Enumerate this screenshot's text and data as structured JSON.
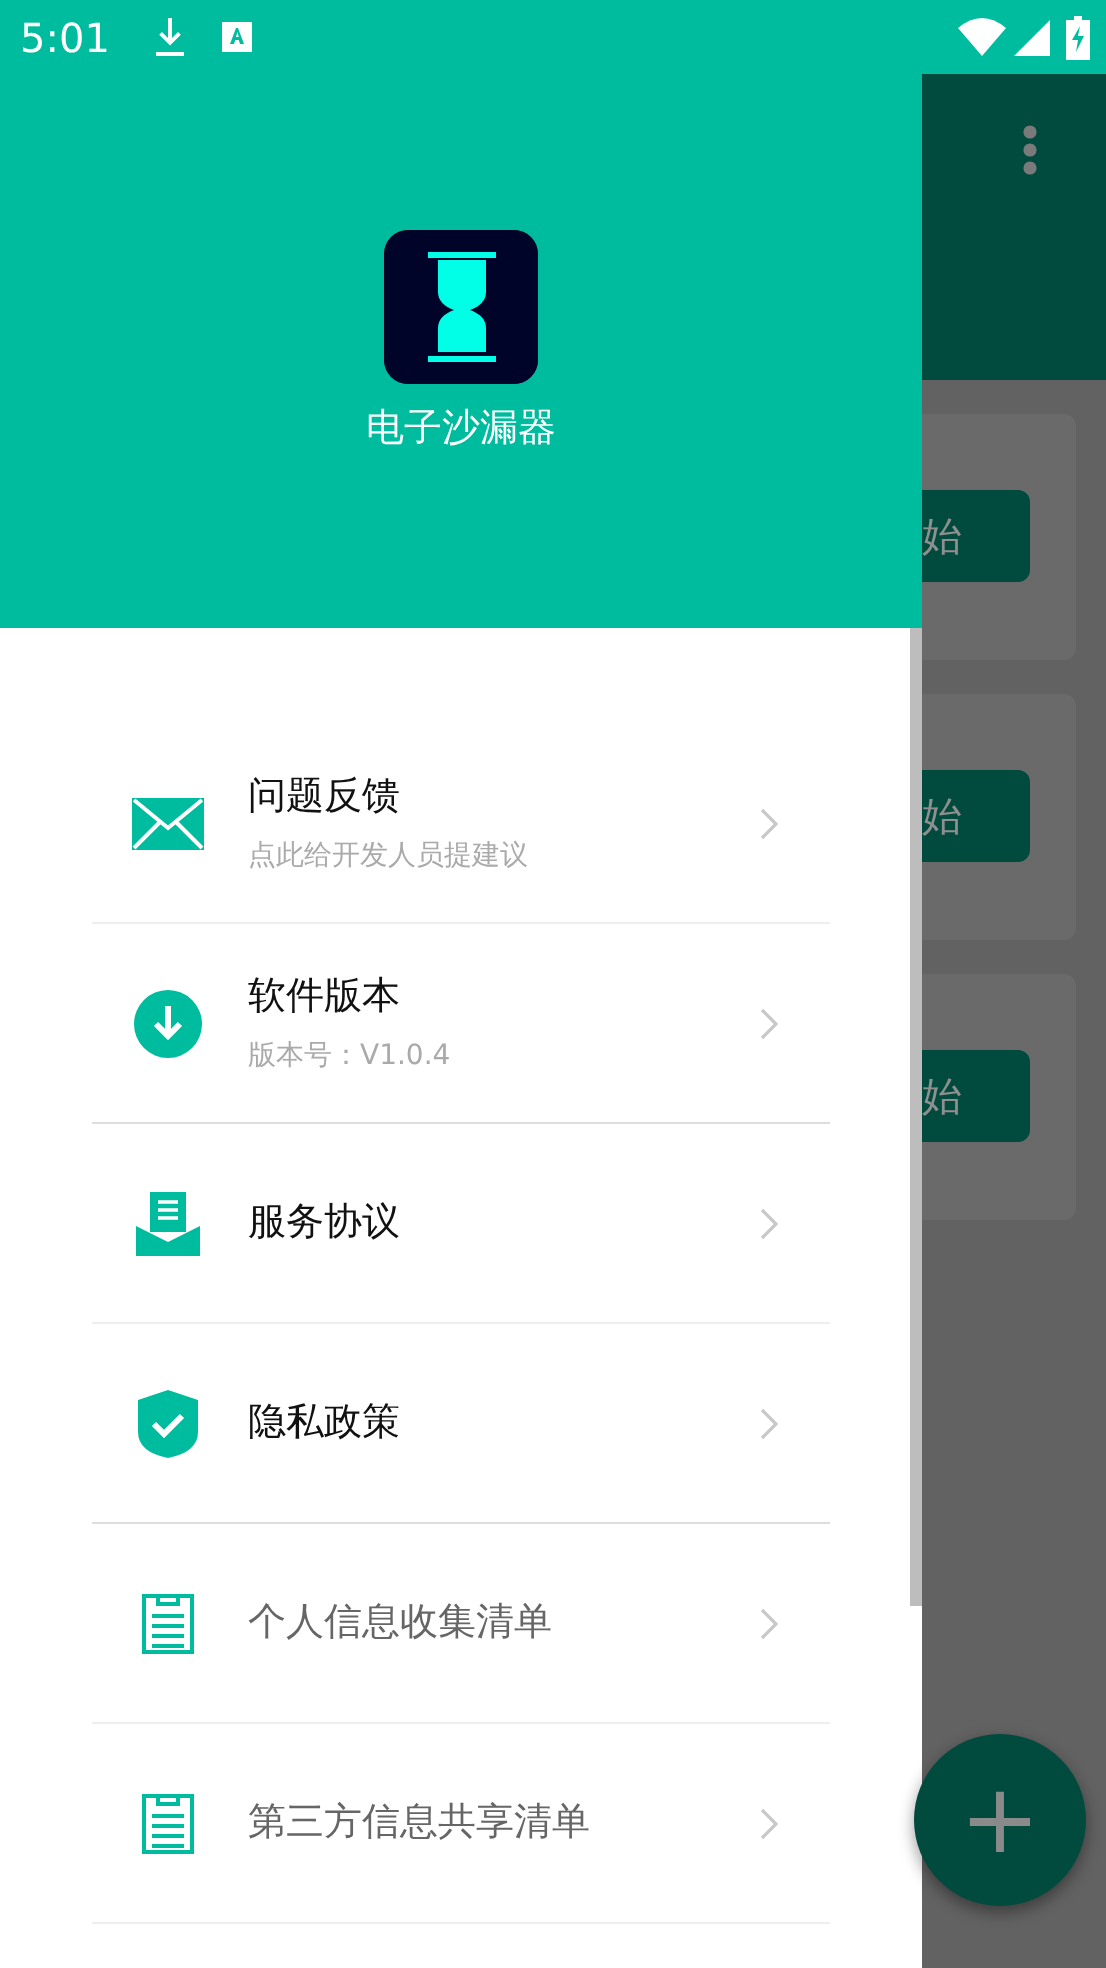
{
  "status_bar": {
    "time": "5:01"
  },
  "drawer": {
    "app_name": "电子沙漏器",
    "items": [
      {
        "title": "问题反馈",
        "subtitle": "点此给开发人员提建议",
        "dimmed": false
      },
      {
        "title": "软件版本",
        "subtitle": "版本号：V1.0.4",
        "dimmed": false
      },
      {
        "title": "服务协议",
        "dimmed": false
      },
      {
        "title": "隐私政策",
        "dimmed": false
      },
      {
        "title": "个人信息收集清单",
        "dimmed": true
      },
      {
        "title": "第三方信息共享清单",
        "dimmed": true
      }
    ]
  },
  "background": {
    "cards": [
      {
        "button": "始"
      },
      {
        "button": "始"
      },
      {
        "button": "始"
      }
    ],
    "fab": "+"
  }
}
